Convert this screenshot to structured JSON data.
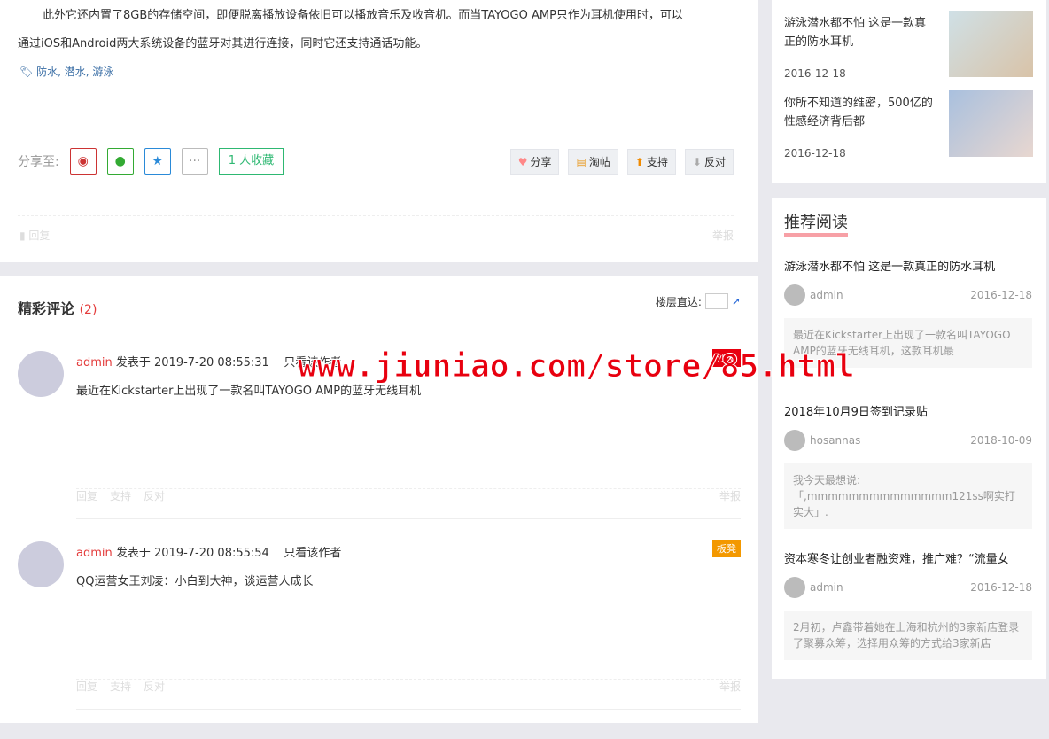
{
  "article": {
    "para1": "此外它还内置了8GB的存储空间，即便脱离播放设备依旧可以播放音乐及收音机。而当TAYOGO AMP只作为耳机使用时，可以",
    "para2": "通过iOS和Android两大系统设备的蓝牙对其进行连接，同时它还支持通话功能。",
    "tags": "防水, 潜水, 游泳",
    "share_label": "分享至:",
    "fav_label": "1 人收藏",
    "actions": [
      "分享",
      "淘帖",
      "支持",
      "反对"
    ],
    "reply": "回复",
    "report": "举报"
  },
  "comments": {
    "title": "精彩评论",
    "count": "(2)",
    "floor_label": "楼层直达:",
    "items": [
      {
        "user": "admin",
        "posted": "发表于 2019-7-20 08:55:31",
        "only_author": "只看该作者",
        "badge": "沙发",
        "badge_color": "#e8000f",
        "text": "最近在Kickstarter上出现了一款名叫TAYOGO AMP的蓝牙无线耳机"
      },
      {
        "user": "admin",
        "posted": "发表于 2019-7-20 08:55:54",
        "only_author": "只看该作者",
        "badge": "板凳",
        "badge_color": "#f39800",
        "text": "QQ运营女王刘凌：小白到大神，谈运营人成长"
      }
    ],
    "reply": "回复",
    "support": "支持",
    "oppose": "反对",
    "report": "举报"
  },
  "side_top": [
    {
      "title": "游泳潜水都不怕 这是一款真正的防水耳机",
      "date": "2016-12-18"
    },
    {
      "title": "你所不知道的维密，500亿的性感经济背后都",
      "date": "2016-12-18"
    }
  ],
  "recommend": {
    "title": "推荐阅读",
    "items": [
      {
        "title": "游泳潜水都不怕 这是一款真正的防水耳机",
        "user": "admin",
        "date": "2016-12-18",
        "excerpt": "最近在Kickstarter上出现了一款名叫TAYOGO AMP的蓝牙无线耳机，这款耳机最"
      },
      {
        "title": "2018年10月9日签到记录贴",
        "user": "hosannas",
        "date": "2018-10-09",
        "excerpt": "我今天最想说:「,mmmmmmmmmmmmmm121ss啊实打实大」."
      },
      {
        "title": "资本寒冬让创业者融资难，推广难？“流量女",
        "user": "admin",
        "date": "2016-12-18",
        "excerpt": "2月初，卢鑫带着她在上海和杭州的3家新店登录了聚募众筹，选择用众筹的方式给3家新店"
      }
    ]
  },
  "watermark": "www.jiuniao.com/store/85.html"
}
